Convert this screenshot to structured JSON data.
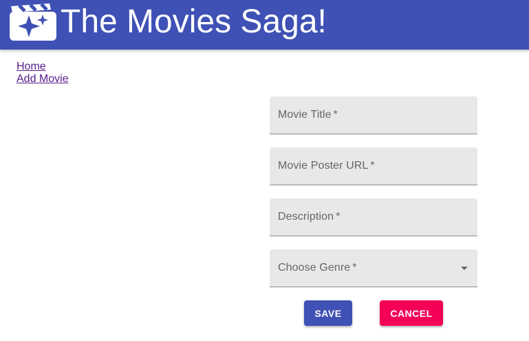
{
  "header": {
    "title": "The Movies Saga!",
    "background": "#3f51b5",
    "logo_icon": "movie-clapperboard-sparkle-icon"
  },
  "nav": {
    "links": [
      "Home",
      "Add Movie"
    ]
  },
  "form": {
    "title_label": "Movie Title",
    "poster_label": "Movie Poster URL",
    "description_label": "Description",
    "genre_label": "Choose Genre",
    "required_marker": "*",
    "save_label": "SAVE",
    "cancel_label": "CANCEL"
  },
  "colors": {
    "primary": "#3f51b5",
    "secondary": "#f50057",
    "field_background": "#e8e8e8"
  }
}
